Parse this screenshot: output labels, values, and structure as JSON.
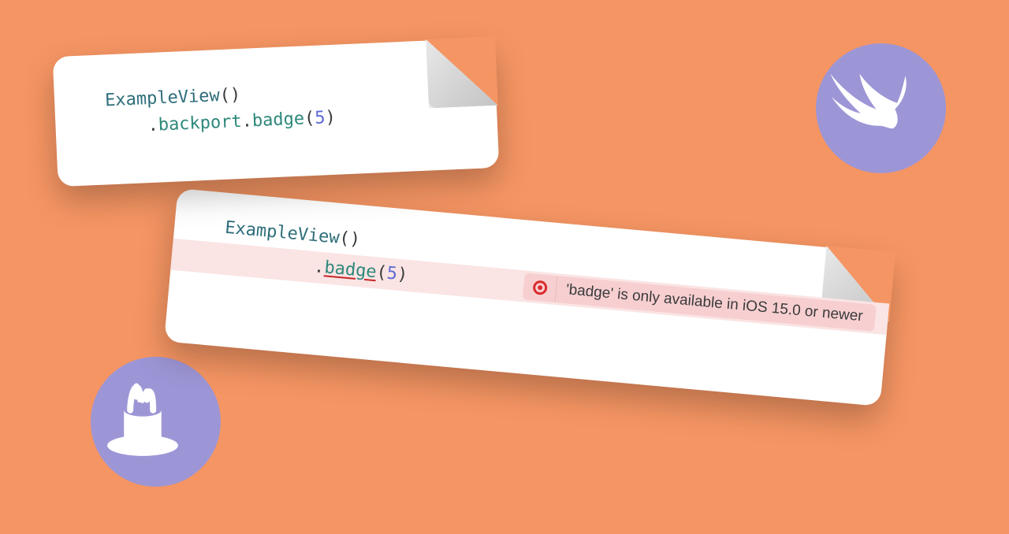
{
  "colors": {
    "background": "#f59563",
    "badge": "#9d96d6",
    "codeType": "#2e6e7a",
    "codeMember": "#2e887a",
    "codeNumber": "#5e6ad5",
    "errorBg": "#fbe4e4",
    "errorPill": "#f7cfd1",
    "errorRed": "#d92b2b"
  },
  "topCard": {
    "line1_type": "ExampleView",
    "line1_parens": "()",
    "line2_indent": "    ",
    "line2_dot1": ".",
    "line2_backport": "backport",
    "line2_dot2": ".",
    "line2_badge": "badge",
    "line2_open": "(",
    "line2_arg": "5",
    "line2_close": ")"
  },
  "bottomCard": {
    "line1_type": "ExampleView",
    "line1_parens": "()",
    "line2_indent": "    ",
    "line2_dot": ".",
    "line2_badge": "badge",
    "line2_open": "(",
    "line2_arg": "5",
    "line2_close": ")",
    "error_message": "'badge' is only available in iOS 15.0 or newer"
  },
  "icons": {
    "swift": "swift-bird-icon",
    "magic": "magic-hat-icon",
    "error": "error-dot-icon"
  }
}
